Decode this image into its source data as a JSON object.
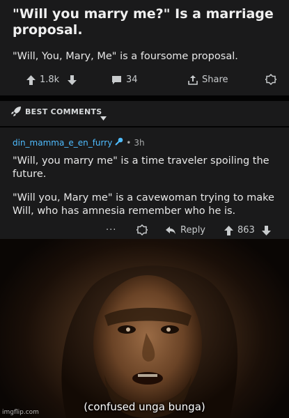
{
  "post": {
    "title": "\"Will you marry me?\" Is a marriage proposal.",
    "body": "\"Will, You, Mary, Me\" is a foursome proposal.",
    "upvotes": "1.8k",
    "comments": "34",
    "share_label": "Share"
  },
  "sort_bar": {
    "label": "BEST COMMENTS"
  },
  "comment": {
    "author": "din_mamma_e_en_furry",
    "time": "3h",
    "paragraphs": [
      "\"Will, you marry me\" is a time traveler spoiling the future.",
      "\"Will you, Mary me\" is a cavewoman trying to make Will, who has amnesia remember who he is."
    ],
    "more": "···",
    "reply_label": "Reply",
    "score": "863"
  },
  "meme": {
    "caption": "(confused unga bunga)",
    "watermark": "imgflip.com"
  },
  "colors": {
    "background": "#1a1a1b",
    "username": "#4fbcff",
    "text": "#e8e8e8"
  }
}
